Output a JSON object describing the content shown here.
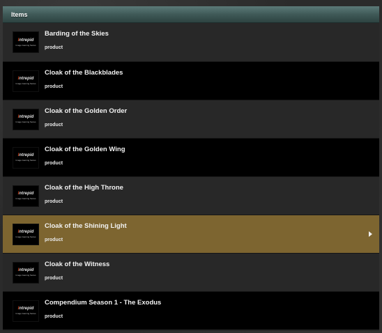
{
  "header": {
    "title": "Items"
  },
  "thumbnail": {
    "logo": "Intrepid",
    "logo_accent": "I",
    "tagline": "Image Gaming Series"
  },
  "items": [
    {
      "title": "Barding of the Skies",
      "subtitle": "product",
      "selected": false
    },
    {
      "title": "Cloak of the Blackblades",
      "subtitle": "product",
      "selected": false
    },
    {
      "title": "Cloak of the Golden Order",
      "subtitle": "product",
      "selected": false
    },
    {
      "title": "Cloak of the Golden Wing",
      "subtitle": "product",
      "selected": false
    },
    {
      "title": "Cloak of the High Throne",
      "subtitle": "product",
      "selected": false
    },
    {
      "title": "Cloak of the Shining Light",
      "subtitle": "product",
      "selected": true
    },
    {
      "title": "Cloak of the Witness",
      "subtitle": "product",
      "selected": false
    },
    {
      "title": "Compendium Season 1 - The Exodus",
      "subtitle": "product",
      "selected": false
    }
  ],
  "colors": {
    "selected": "#7d6530",
    "header": "#3d5755"
  },
  "icons": {
    "selected_indicator": "chevron-right-icon"
  }
}
